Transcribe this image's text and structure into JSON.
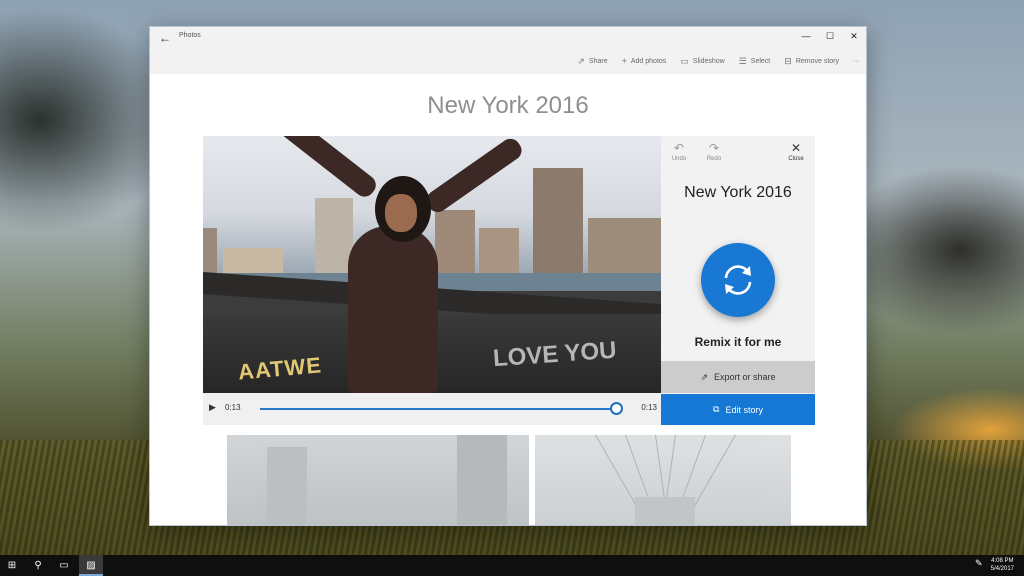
{
  "window": {
    "app_title": "Photos",
    "controls": {
      "minimize": "—",
      "maximize": "☐",
      "close": "✕"
    }
  },
  "commands": [
    {
      "label": "Share",
      "icon": "share-icon",
      "glyph": "⇗"
    },
    {
      "label": "Add photos",
      "icon": "plus-icon",
      "glyph": "+"
    },
    {
      "label": "Slideshow",
      "icon": "slideshow-icon",
      "glyph": "▭"
    },
    {
      "label": "Select",
      "icon": "select-icon",
      "glyph": "☰"
    },
    {
      "label": "Remove story",
      "icon": "remove-story-icon",
      "glyph": "⊟"
    }
  ],
  "more_glyph": "···",
  "page": {
    "title": "New York 2016"
  },
  "photo": {
    "graffiti_1": "AATWE",
    "graffiti_2": "LOVE YOU"
  },
  "playback": {
    "current_time": "0:13",
    "total_time": "0:13",
    "progress": 1.0,
    "accent_color": "#2777c8"
  },
  "panel": {
    "undo_label": "Undo",
    "redo_label": "Redo",
    "close_label": "Close",
    "title": "New York 2016",
    "remix_label": "Remix it for me",
    "export_label": "Export or share",
    "edit_label": "Edit story",
    "remix_color": "#1878d4",
    "edit_color": "#1478d4"
  },
  "taskbar": {
    "time": "4:08 PM",
    "date": "5/4/2017",
    "icons": [
      "windows-start-icon",
      "search-icon",
      "task-view-icon",
      "photos-app-icon"
    ]
  }
}
